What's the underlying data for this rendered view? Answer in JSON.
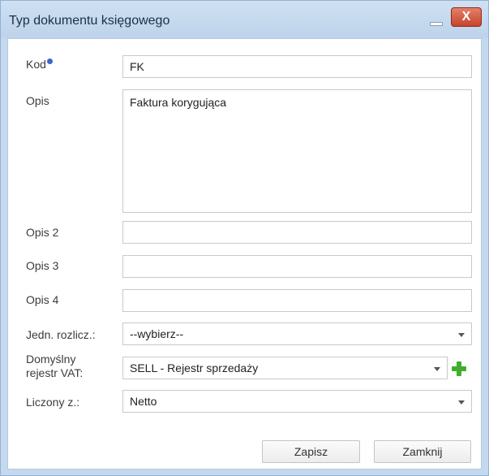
{
  "window": {
    "title": "Typ dokumentu księgowego",
    "close_glyph": "X"
  },
  "form": {
    "kod": {
      "label": "Kod",
      "value": "FK"
    },
    "opis": {
      "label": "Opis",
      "value": "Faktura korygująca"
    },
    "opis2": {
      "label": "Opis 2",
      "value": ""
    },
    "opis3": {
      "label": "Opis 3",
      "value": ""
    },
    "opis4": {
      "label": "Opis 4",
      "value": ""
    },
    "jedn": {
      "label": "Jedn. rozlicz.:",
      "value": "--wybierz--"
    },
    "rejestr": {
      "label_line1": "Domyślny",
      "label_line2": "rejestr VAT:",
      "value": "SELL - Rejestr sprzedaży"
    },
    "liczony": {
      "label": "Liczony z.:",
      "value": "Netto"
    }
  },
  "buttons": {
    "save": "Zapisz",
    "close": "Zamknij"
  },
  "colors": {
    "titlebar": "#c5d9ee",
    "close_button": "#c8432c",
    "add_icon": "#3fae2a",
    "info_icon": "#3c66c4"
  },
  "icons": [
    "info-icon",
    "minimize-icon",
    "close-icon",
    "chevron-down-icon",
    "add-icon"
  ]
}
